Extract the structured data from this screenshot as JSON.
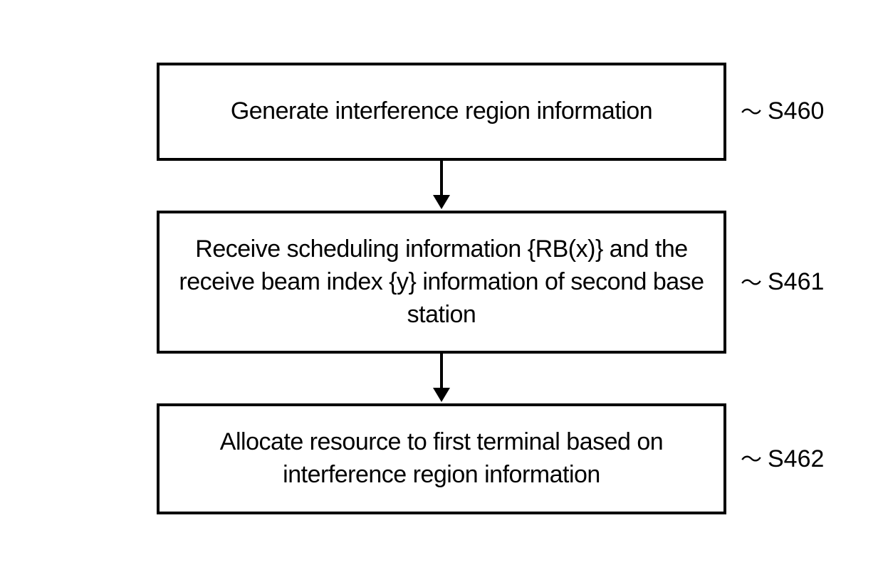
{
  "flowchart": {
    "steps": [
      {
        "text": "Generate interference region information",
        "label": "S460",
        "singleLine": true
      },
      {
        "text": "Receive scheduling information {RB(x)} and the receive beam index {y} information of second base station",
        "label": "S461",
        "singleLine": false
      },
      {
        "text": "Allocate resource to first terminal based on interference region information",
        "label": "S462",
        "singleLine": false
      }
    ]
  }
}
